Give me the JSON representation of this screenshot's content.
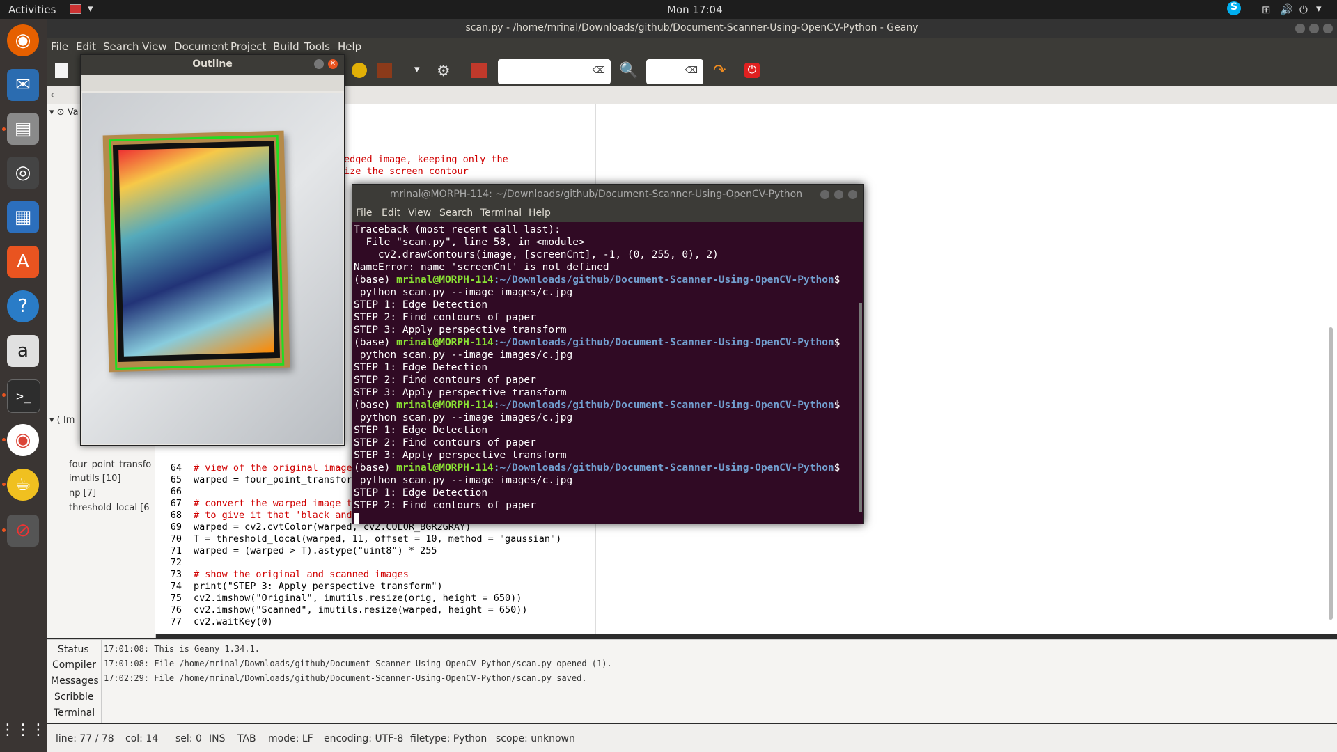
{
  "topbar": {
    "activities": "Activities",
    "clock": "Mon 17:04"
  },
  "geany": {
    "title": "scan.py - /home/mrinal/Downloads/github/Document-Scanner-Using-OpenCV-Python - Geany",
    "menu": [
      "File",
      "Edit",
      "Search",
      "View",
      "Document",
      "Project",
      "Build",
      "Tools",
      "Help"
    ],
    "sidebar": [
      "Va",
      "Im",
      "four_point_transfo",
      "imutils [10]",
      "np [7]",
      "threshold_local [6"
    ],
    "code_lines": [
      {
        "n": "",
        "t": "edged image, keeping only the",
        "c": "cm"
      },
      {
        "n": "",
        "t": "ize the screen contour",
        "c": "cm"
      }
    ],
    "line_numbers": [
      "64",
      "65",
      "66",
      "67",
      "68",
      "69",
      "70",
      "71",
      "72",
      "73",
      "74",
      "75",
      "76",
      "77"
    ],
    "code": [
      "# view of the original image",
      "warped = four_point_transfor",
      "",
      "# convert the warped image t",
      "# to give it that 'black and",
      "warped = cv2.cvtColor(warped, cv2.COLOR_BGR2GRAY)",
      "T = threshold_local(warped, 11, offset = 10, method = \"gaussian\")",
      "warped = (warped > T).astype(\"uint8\") * 255",
      "",
      "# show the original and scanned images",
      "print(\"STEP 3: Apply perspective transform\")",
      "cv2.imshow(\"Original\", imutils.resize(orig, height = 650))",
      "cv2.imshow(\"Scanned\", imutils.resize(warped, height = 650))",
      "cv2.waitKey(0)"
    ],
    "msg_tabs": [
      "Status",
      "Compiler",
      "Messages",
      "Scribble",
      "Terminal"
    ],
    "messages": [
      "17:01:08: This is Geany 1.34.1.",
      "17:01:08: File /home/mrinal/Downloads/github/Document-Scanner-Using-OpenCV-Python/scan.py opened (1).",
      "17:02:29: File /home/mrinal/Downloads/github/Document-Scanner-Using-OpenCV-Python/scan.py saved."
    ],
    "status": {
      "line": "line: 77 / 78",
      "col": "col: 14",
      "sel": "sel: 0",
      "ins": "INS",
      "tab": "TAB",
      "mode": "mode: LF",
      "encoding": "encoding: UTF-8",
      "filetype": "filetype: Python",
      "scope": "scope: unknown"
    }
  },
  "outline": {
    "title": "Outline"
  },
  "terminal": {
    "title": "mrinal@MORPH-114: ~/Downloads/github/Document-Scanner-Using-OpenCV-Python",
    "menu": [
      "File",
      "Edit",
      "View",
      "Search",
      "Terminal",
      "Help"
    ],
    "prompt_base": "(base) ",
    "prompt_user": "mrinal@MORPH-114",
    "prompt_path": ":~/Downloads/github/Document-Scanner-Using-OpenCV-Python",
    "prompt_end": "$",
    "traceback": [
      "Traceback (most recent call last):",
      "  File \"scan.py\", line 58, in <module>",
      "    cv2.drawContours(image, [screenCnt], -1, (0, 255, 0), 2)",
      "NameError: name 'screenCnt' is not defined"
    ],
    "command": " python scan.py --image images/c.jpg",
    "step1": "STEP 1: Edge Detection",
    "step2": "STEP 2: Find contours of paper",
    "step3": "STEP 3: Apply perspective transform"
  }
}
